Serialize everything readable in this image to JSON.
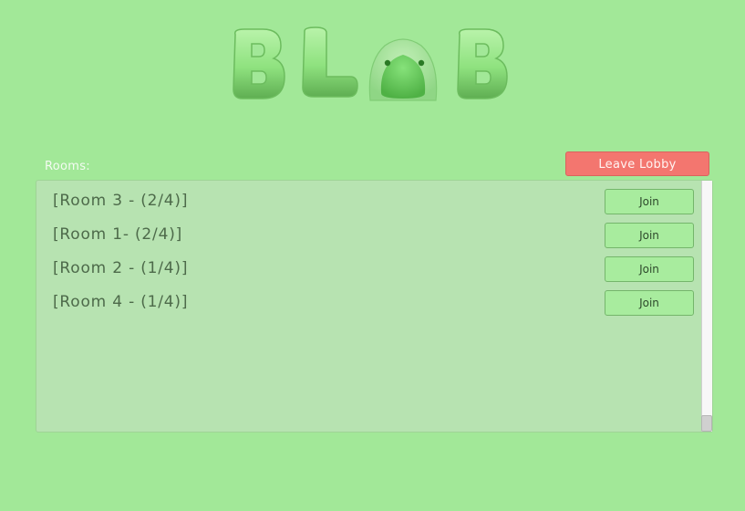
{
  "logo": {
    "letters": [
      "B",
      "L",
      "B"
    ],
    "colors": {
      "letter": "#8fe27f",
      "letter_shadow": "#5fae52",
      "blob_body": "#63c75a",
      "blob_dome": "#9edf93",
      "blob_eye": "#2b7a26"
    }
  },
  "lobby": {
    "rooms_label": "Rooms:",
    "leave_label": "Leave Lobby"
  },
  "rooms": [
    {
      "name": "[Room 3 - (2/4)]",
      "join_label": "Join"
    },
    {
      "name": "[Room 1- (2/4)]",
      "join_label": "Join"
    },
    {
      "name": "[Room 2 - (1/4)]",
      "join_label": "Join"
    },
    {
      "name": "[Room 4 - (1/4)]",
      "join_label": "Join"
    }
  ],
  "colors": {
    "background": "#a2e898",
    "panel": "#b7e3b1",
    "leave_button": "#f3766f",
    "join_button": "#a8ec9e"
  }
}
